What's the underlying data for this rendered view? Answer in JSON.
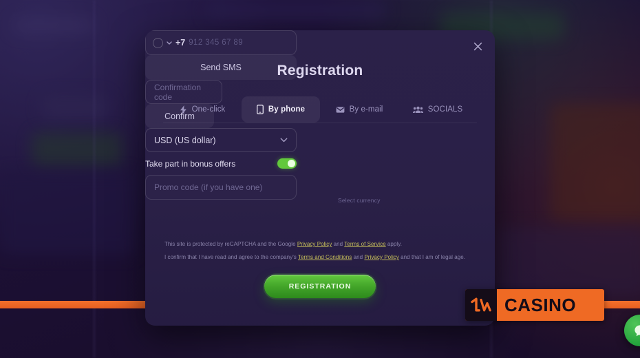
{
  "modal": {
    "title": "Registration",
    "close_icon": "close-icon",
    "tabs": [
      {
        "label": "One-click",
        "icon": "lightning-icon",
        "active": false
      },
      {
        "label": "By phone",
        "icon": "smartphone-icon",
        "active": true
      },
      {
        "label": "By e-mail",
        "icon": "envelope-icon",
        "active": false
      },
      {
        "label": "SOCIALS",
        "icon": "people-icon",
        "active": false
      }
    ],
    "phone": {
      "country_flag": "russia-flag-icon",
      "country_code": "+7",
      "placeholder": "912 345 67 89",
      "value": "",
      "dropdown_icon": "chevron-down-icon"
    },
    "send_sms_label": "Send SMS",
    "confirmation_code_placeholder": "Confirmation code",
    "confirmation_code_value": "",
    "confirm_label": "Confirm",
    "currency": {
      "label": "Select currency",
      "selected": "USD (US dollar)",
      "dropdown_icon": "chevron-down-icon"
    },
    "bonus": {
      "label": "Take part in bonus offers",
      "enabled": true
    },
    "promo": {
      "placeholder": "Promo code (if you have one)",
      "value": ""
    },
    "legal": {
      "line1_pre": "This site is protected by reCAPTCHA and the Google ",
      "line1_link1": "Privacy Policy",
      "line1_mid": " and ",
      "line1_link2": "Terms of Service",
      "line1_post": " apply.",
      "line2_pre": "I confirm that I have read and agree to the company's ",
      "line2_link1": "Terms and Conditions",
      "line2_mid": " and ",
      "line2_link2": "Privacy Policy",
      "line2_post": " and that I am of legal age."
    },
    "submit_label": "REGISTRATION"
  },
  "branding": {
    "logo_text": "CASINO",
    "logo_mark_icon": "one-win-mark-icon",
    "logo_bg": "#ef6a24",
    "stripe_color": "#ef6a24"
  },
  "chat_widget": {
    "icon": "chat-bubble-icon",
    "color": "#22a13b"
  },
  "colors": {
    "accent_green": "#62c83c",
    "accent_orange": "#ef6a24",
    "modal_bg": "#2a2047",
    "link": "#c7bf5a"
  }
}
